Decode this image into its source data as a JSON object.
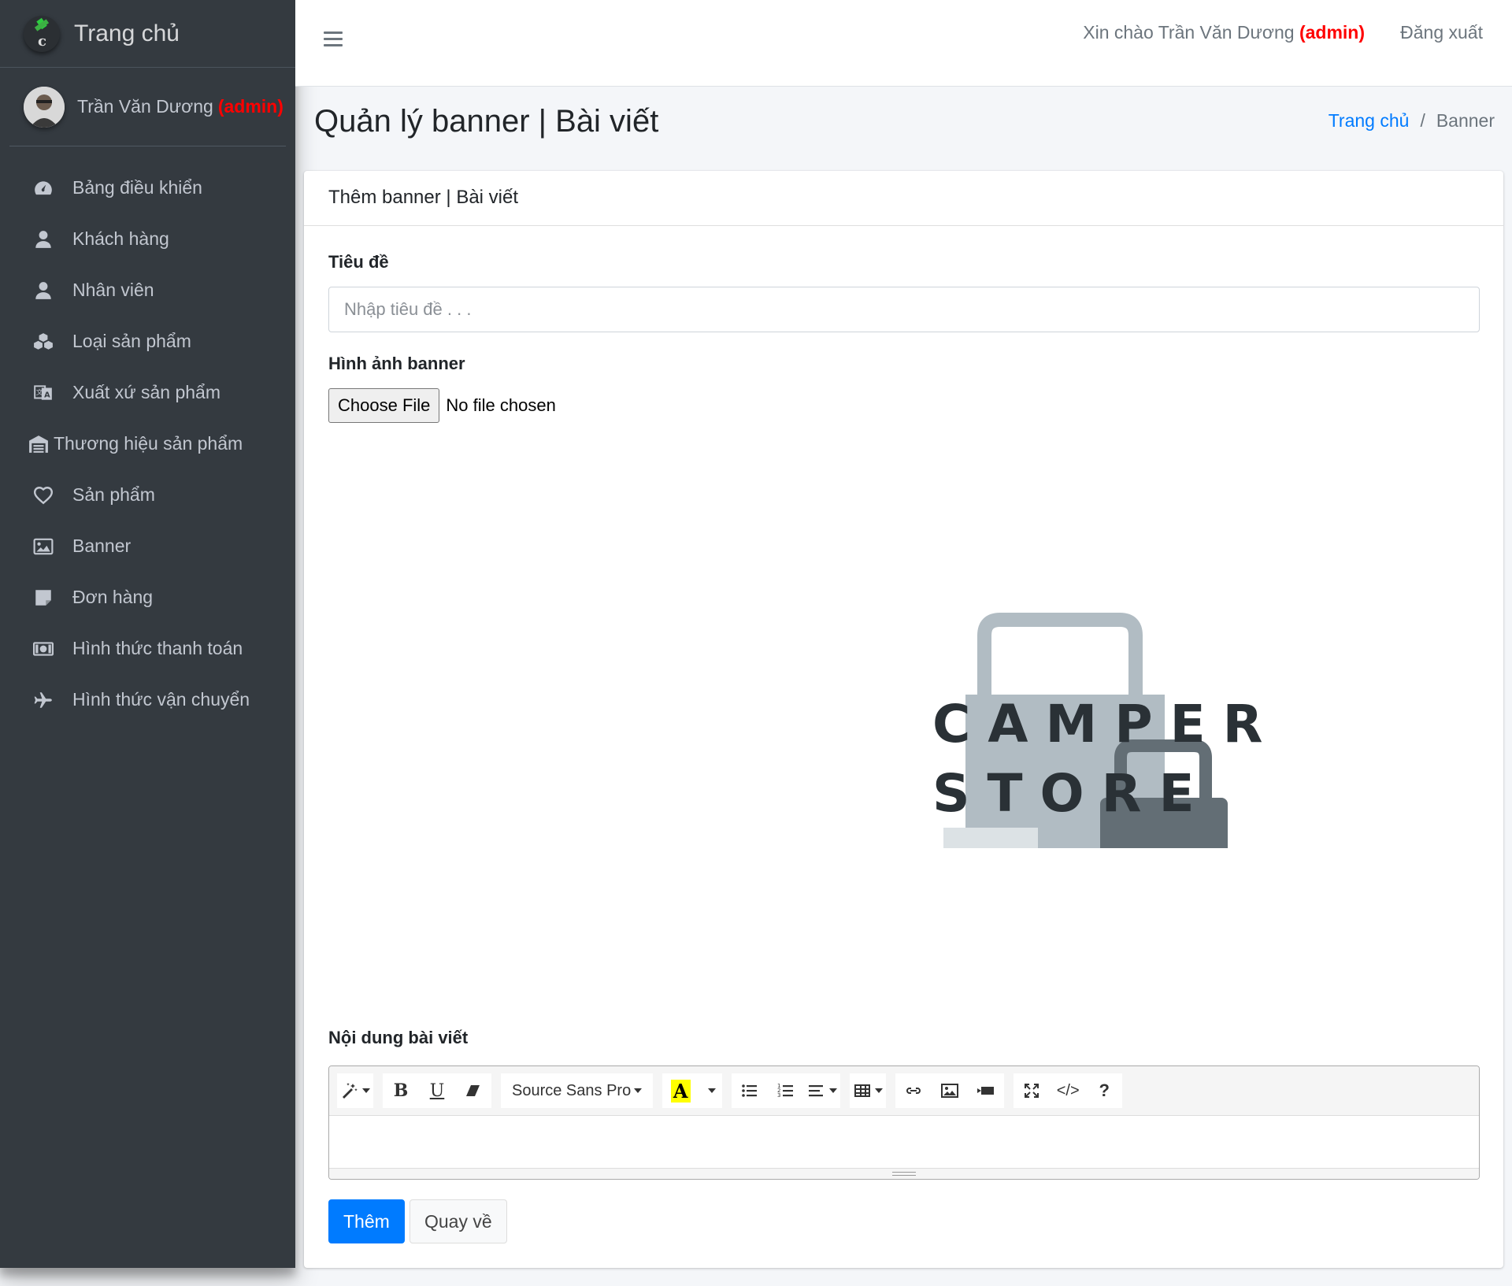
{
  "sidebar": {
    "brand": "Trang chủ",
    "user_name": "Trần Văn Dương",
    "user_role": "(admin)",
    "items": [
      {
        "label": "Bảng điều khiển",
        "icon": "tachometer-icon"
      },
      {
        "label": "Khách hàng",
        "icon": "user-icon"
      },
      {
        "label": "Nhân viên",
        "icon": "user-icon"
      },
      {
        "label": "Loại sản phẩm",
        "icon": "cubes-icon"
      },
      {
        "label": "Xuất xứ sản phẩm",
        "icon": "language-icon"
      },
      {
        "label": "Thương hiệu sản phẩm",
        "icon": "warehouse-icon"
      },
      {
        "label": "Sản phẩm",
        "icon": "heart-icon"
      },
      {
        "label": "Banner",
        "icon": "image-icon"
      },
      {
        "label": "Đơn hàng",
        "icon": "sticky-note-icon"
      },
      {
        "label": "Hình thức thanh toán",
        "icon": "money-bill-icon"
      },
      {
        "label": "Hình thức vận chuyển",
        "icon": "plane-icon"
      }
    ]
  },
  "topbar": {
    "greeting": "Xin chào Trần Văn Dương",
    "role": "(admin)",
    "logout": "Đăng xuất"
  },
  "header": {
    "title": "Quản lý banner | Bài viết",
    "breadcrumb_home": "Trang chủ",
    "breadcrumb_sep": "/",
    "breadcrumb_current": "Banner"
  },
  "card": {
    "title": "Thêm banner | Bài viết",
    "title_label": "Tiêu đề",
    "title_placeholder": "Nhập tiêu đề . . .",
    "image_label": "Hình ảnh banner",
    "file_button": "Choose File",
    "file_status": "No file chosen",
    "preview_line1": "CAMPER",
    "preview_line2": "STORE",
    "content_label": "Nội dung bài viết",
    "font_name": "Source Sans Pro",
    "submit": "Thêm",
    "back": "Quay về"
  },
  "colors": {
    "sidebar_bg": "#343a40",
    "primary": "#007bff",
    "admin_red": "#ff0000"
  }
}
